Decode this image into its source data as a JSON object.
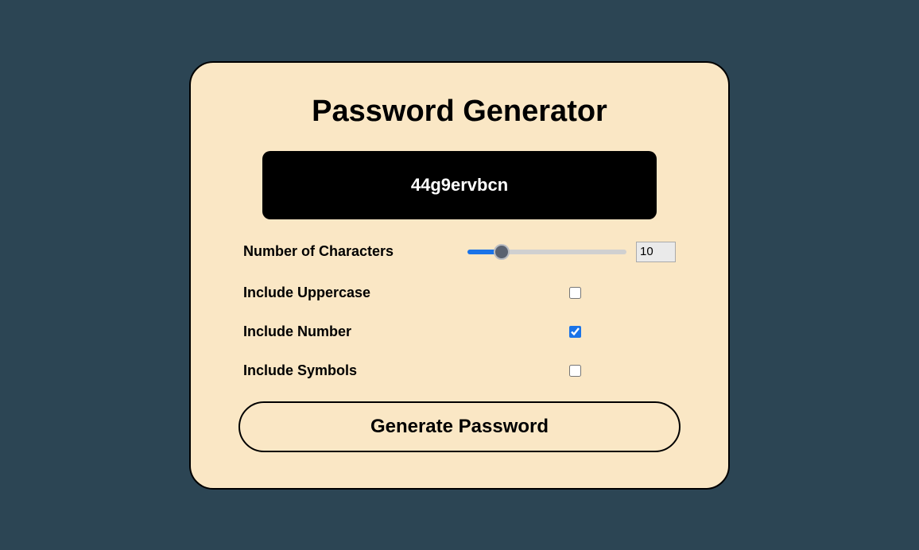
{
  "title": "Password Generator",
  "password": "44g9ervbcn",
  "controls": {
    "length": {
      "label": "Number of Characters",
      "value": "10",
      "min": "1",
      "max": "50"
    },
    "uppercase": {
      "label": "Include Uppercase",
      "checked": false
    },
    "number": {
      "label": "Include Number",
      "checked": true
    },
    "symbols": {
      "label": "Include Symbols",
      "checked": false
    }
  },
  "generate_label": "Generate Password"
}
